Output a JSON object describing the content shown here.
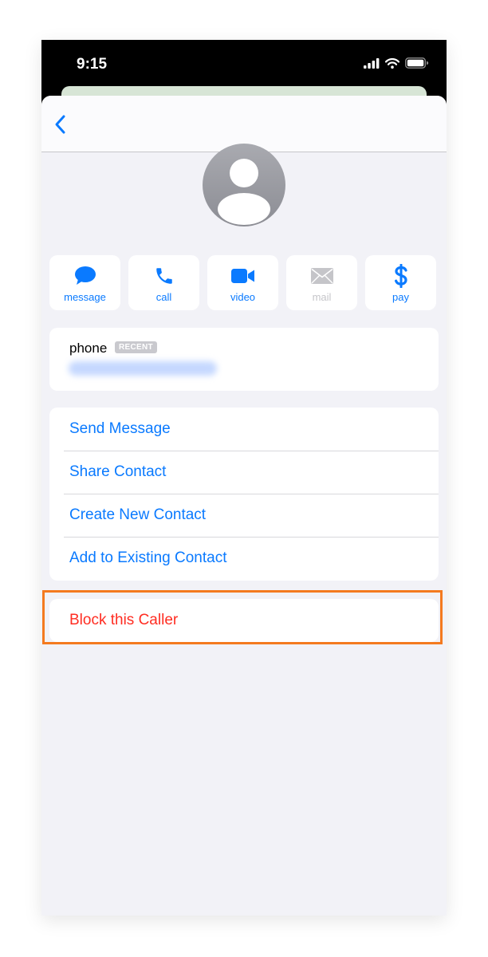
{
  "status_bar": {
    "time": "9:15"
  },
  "navigation": {
    "back_icon": "chevron-left-icon"
  },
  "contact": {
    "avatar_icon": "person-silhouette-icon"
  },
  "actions": [
    {
      "label": "message",
      "icon": "message-bubble-icon",
      "enabled": true
    },
    {
      "label": "call",
      "icon": "phone-icon",
      "enabled": true
    },
    {
      "label": "video",
      "icon": "video-camera-icon",
      "enabled": true
    },
    {
      "label": "mail",
      "icon": "envelope-icon",
      "enabled": false
    },
    {
      "label": "pay",
      "icon": "dollar-icon",
      "enabled": true
    }
  ],
  "phone_section": {
    "label": "phone",
    "badge": "RECENT"
  },
  "options": [
    "Send Message",
    "Share Contact",
    "Create New Contact",
    "Add to Existing Contact"
  ],
  "block_action": "Block this Caller",
  "colors": {
    "accent": "#0a7aff",
    "destructive": "#ff2d22",
    "highlight": "#f47a1f",
    "background": "#f2f2f7"
  }
}
